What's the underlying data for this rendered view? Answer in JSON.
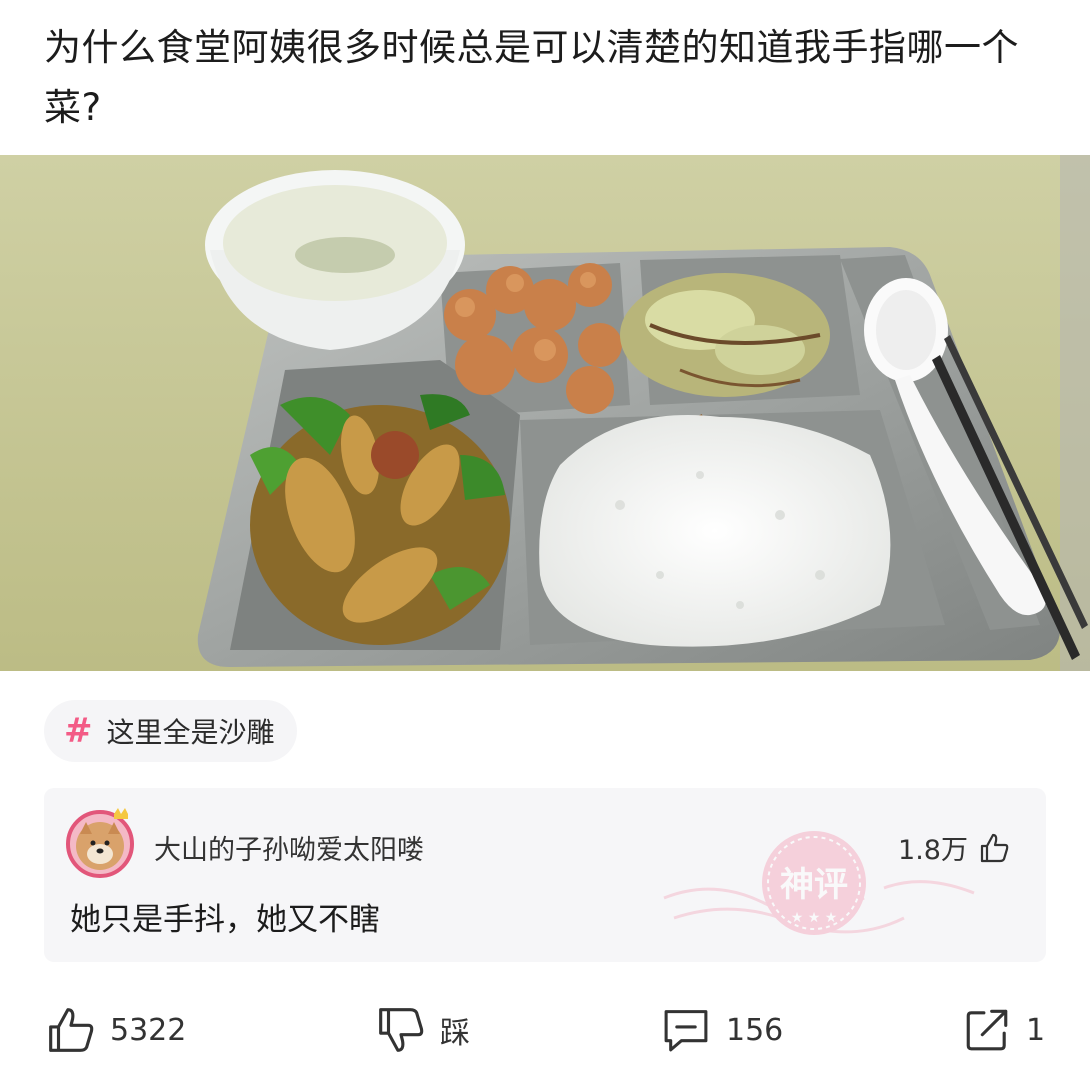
{
  "post": {
    "title": "为什么食堂阿姨很多时候总是可以清楚的知道我手指哪一个菜?"
  },
  "topic": {
    "icon": "hashtag-icon",
    "label": "这里全是沙雕"
  },
  "top_comment": {
    "user": "大山的子孙呦爱太阳喽",
    "likes": "1.8万",
    "text": "她只是手抖，她又不瞎",
    "badge_label": "神评"
  },
  "actions": {
    "like_count": "5322",
    "dislike_label": "踩",
    "comment_count": "156",
    "share_count": "1"
  },
  "colors": {
    "accent_pink": "#f35b86",
    "card_bg": "#f6f6f8",
    "table": "#c7c58f"
  }
}
